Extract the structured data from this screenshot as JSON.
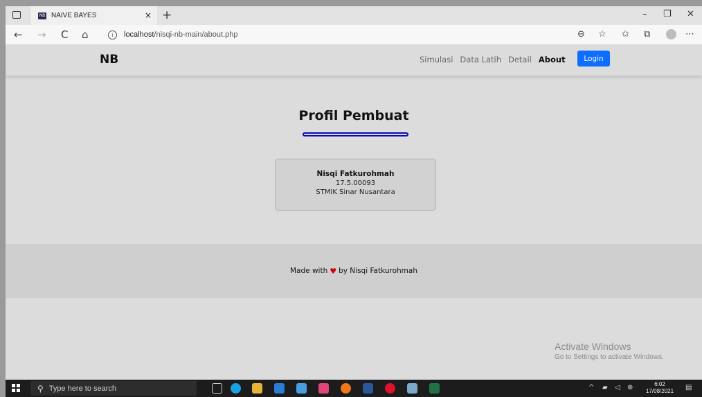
{
  "browser": {
    "tab_title": "NAIVE BAYES",
    "tab_favicon": "NB",
    "tab_close": "×",
    "new_tab": "+",
    "url_host": "localhost",
    "url_path": "/nisqi-nb-main/about.php",
    "window_controls": {
      "minimize": "–",
      "maximize": "❐",
      "close": "✕"
    },
    "nav": {
      "back": "←",
      "forward": "→",
      "refresh": "C",
      "home": "⌂"
    }
  },
  "page": {
    "brand": "NB",
    "nav_links": [
      "Simulasi",
      "Data Latih",
      "Detail",
      "About"
    ],
    "login_label": "Login",
    "section_title": "Profil Pembuat",
    "profile": {
      "name": "Nisqi Fatkurohmah",
      "id": "17.5.00093",
      "institution": "STMIK Sinar Nusantara"
    },
    "footer": {
      "prefix": "Made with",
      "heart": "♥",
      "suffix": "by Nisqi Fatkurohmah"
    }
  },
  "watermark": {
    "title": "Activate Windows",
    "subtitle": "Go to Settings to activate Windows."
  },
  "taskbar": {
    "search_placeholder": "Type here to search",
    "time": "6:02",
    "date": "17/08/2021"
  },
  "colors": {
    "accent": "#0d6efd",
    "underline": "#0a0ab8",
    "heart": "#d10000"
  }
}
